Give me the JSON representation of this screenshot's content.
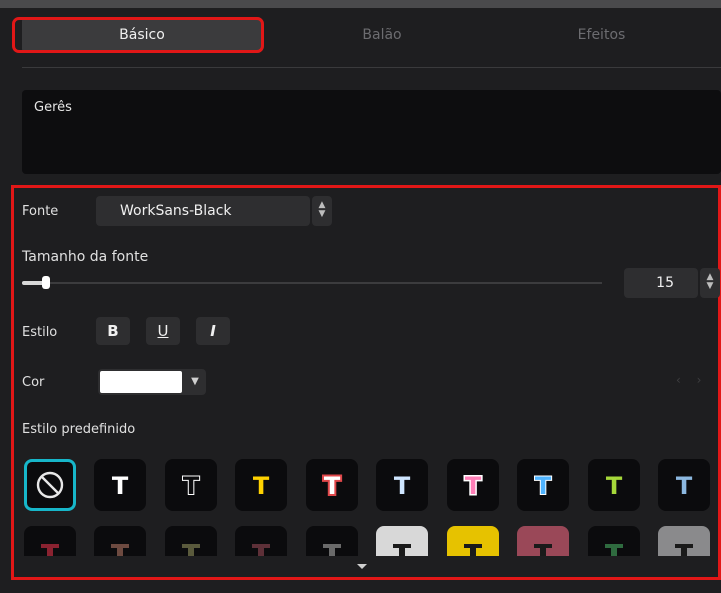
{
  "tabs": [
    {
      "label": "Básico",
      "active": true
    },
    {
      "label": "Balão",
      "active": false
    },
    {
      "label": "Efeitos",
      "active": false
    }
  ],
  "text_input": {
    "value": "Gerês"
  },
  "font": {
    "label": "Fonte",
    "value": "WorkSans-Black"
  },
  "font_size": {
    "label": "Tamanho da fonte",
    "value": "15",
    "slider_fraction": 0.04
  },
  "style": {
    "label": "Estilo",
    "buttons": [
      "B",
      "U",
      "I"
    ]
  },
  "color": {
    "label": "Cor",
    "value": "#ffffff"
  },
  "preset": {
    "label": "Estilo predefinido",
    "row1": [
      {
        "icon": "none-icon",
        "selected": true
      },
      {
        "icon": "text-style-white-icon",
        "color": "#ffffff"
      },
      {
        "icon": "text-style-outline-icon",
        "color": "#ffffff"
      },
      {
        "icon": "text-style-yellow-icon",
        "color": "#ffd200"
      },
      {
        "icon": "text-style-red-outline-icon",
        "color": "#ffffff"
      },
      {
        "icon": "text-style-lightblue-icon",
        "color": "#cfe6ff"
      },
      {
        "icon": "text-style-pink-icon",
        "color": "#ff7fb7"
      },
      {
        "icon": "text-style-blue-icon",
        "color": "#4fb4ff"
      },
      {
        "icon": "text-style-green-icon",
        "color": "#a6d83a"
      },
      {
        "icon": "text-style-steel-icon",
        "color": "#8cb8e0"
      }
    ],
    "row2": [
      {
        "icon": "text-style-dark-red-icon",
        "color": "#8a2230"
      },
      {
        "icon": "text-style-brown-icon",
        "color": "#6d4a40"
      },
      {
        "icon": "text-style-olive-icon",
        "color": "#5a5a3c"
      },
      {
        "icon": "text-style-maroon-icon",
        "color": "#5e3038"
      },
      {
        "icon": "text-style-gray-icon",
        "color": "#6a6a6a"
      },
      {
        "icon": "text-style-silver-bg-icon",
        "color": "#d8d8d8"
      },
      {
        "icon": "text-style-gold-bg-icon",
        "color": "#e6c200"
      },
      {
        "icon": "text-style-rose-bg-icon",
        "color": "#9a4858"
      },
      {
        "icon": "text-style-green-dark-icon",
        "color": "#2f6b3f"
      },
      {
        "icon": "text-style-graphite-icon",
        "color": "#8a8a8c"
      }
    ]
  },
  "colors": {
    "highlight": "#e11717",
    "selection": "#17b6c9"
  }
}
